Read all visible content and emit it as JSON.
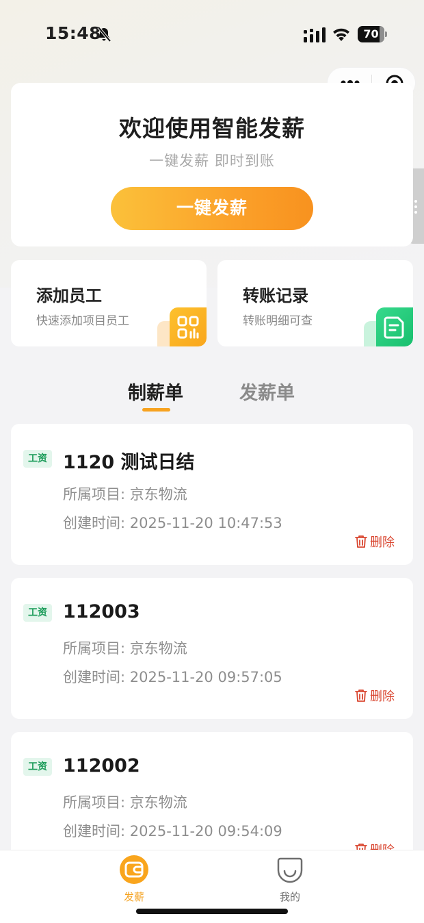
{
  "status_bar": {
    "time": "15:48",
    "battery": "70"
  },
  "hero": {
    "title": "欢迎使用智能发薪",
    "subtitle": "一键发薪 即时到账",
    "button_label": "一键发薪"
  },
  "features": [
    {
      "title": "添加员工",
      "desc": "快速添加项目员工",
      "icon": "qr-grid-icon"
    },
    {
      "title": "转账记录",
      "desc": "转账明细可查",
      "icon": "document-icon"
    }
  ],
  "tabs": [
    {
      "label": "制薪单",
      "active": true
    },
    {
      "label": "发薪单",
      "active": false
    }
  ],
  "cards": [
    {
      "tag": "工资",
      "title": "1120 测试日结",
      "project": "所属项目: 京东物流",
      "created": "创建时间: 2025-11-20 10:47:53",
      "delete_label": "删除"
    },
    {
      "tag": "工资",
      "title": "112003",
      "project": "所属项目: 京东物流",
      "created": "创建时间: 2025-11-20 09:57:05",
      "delete_label": "删除"
    },
    {
      "tag": "工资",
      "title": "112002",
      "project": "所属项目: 京东物流",
      "created": "创建时间: 2025-11-20 09:54:09",
      "delete_label": "删除"
    }
  ],
  "bottom_nav": [
    {
      "label": "发薪",
      "active": true,
      "icon": "wallet-icon"
    },
    {
      "label": "我的",
      "active": false,
      "icon": "smile-icon"
    }
  ],
  "colors": {
    "accent": "#f7a21f",
    "tag_green": "#1c9c5a",
    "delete_red": "#d9452f"
  }
}
